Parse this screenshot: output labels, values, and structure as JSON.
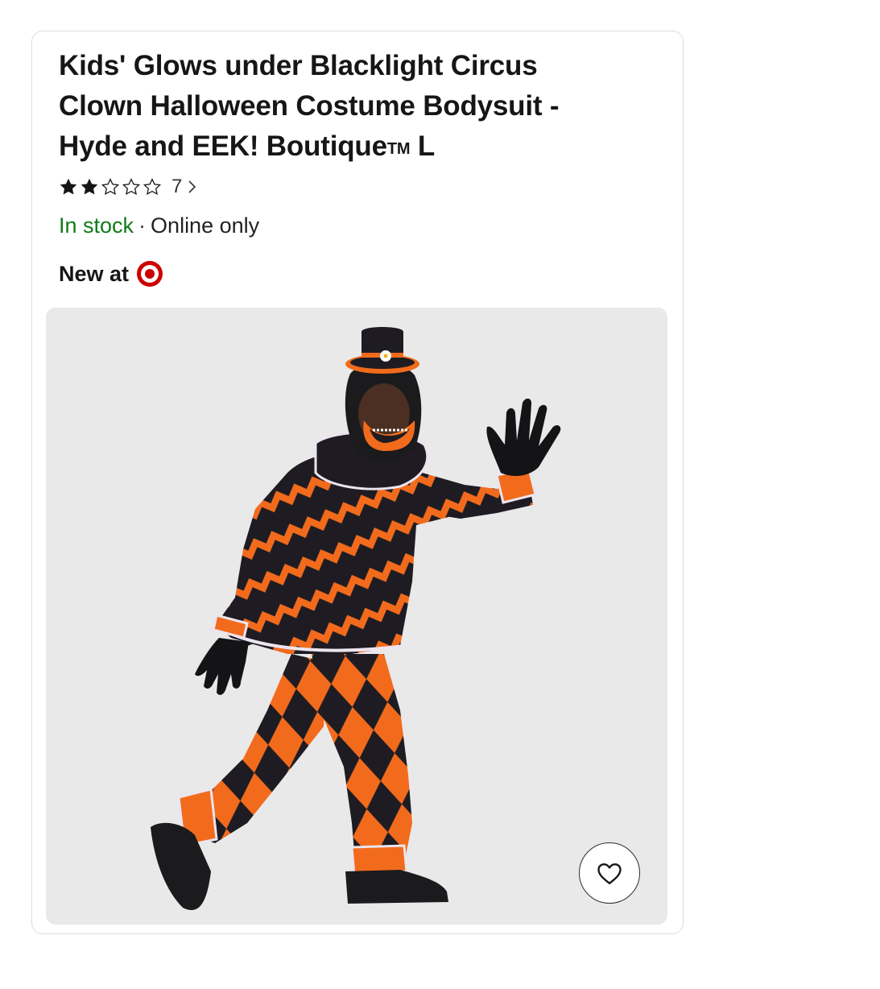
{
  "product": {
    "title_line1": "Kids' Glows under Blacklight Circus",
    "title_line2": "Clown Halloween Costume Bodysuit -",
    "title_line3_main": "Hyde and EEK! Boutique",
    "title_line3_tm": "TM",
    "title_line3_size": "L",
    "rating": {
      "stars_filled": 2,
      "stars_total": 5,
      "review_count": "7",
      "chevron_icon": "chevron-right-icon"
    },
    "availability": {
      "status": "In stock",
      "separator": "·",
      "fulfillment": "Online only",
      "status_color": "#0f7b18"
    },
    "badge": {
      "label": "New at",
      "logo_icon": "target-bullseye-logo",
      "logo_color": "#cc0000"
    },
    "image": {
      "alt": "Child wearing orange and black zigzag and harlequin diamond clown costume with black hood, mini top hat, and black gloves"
    },
    "favorite": {
      "icon": "heart-outline-icon"
    }
  }
}
